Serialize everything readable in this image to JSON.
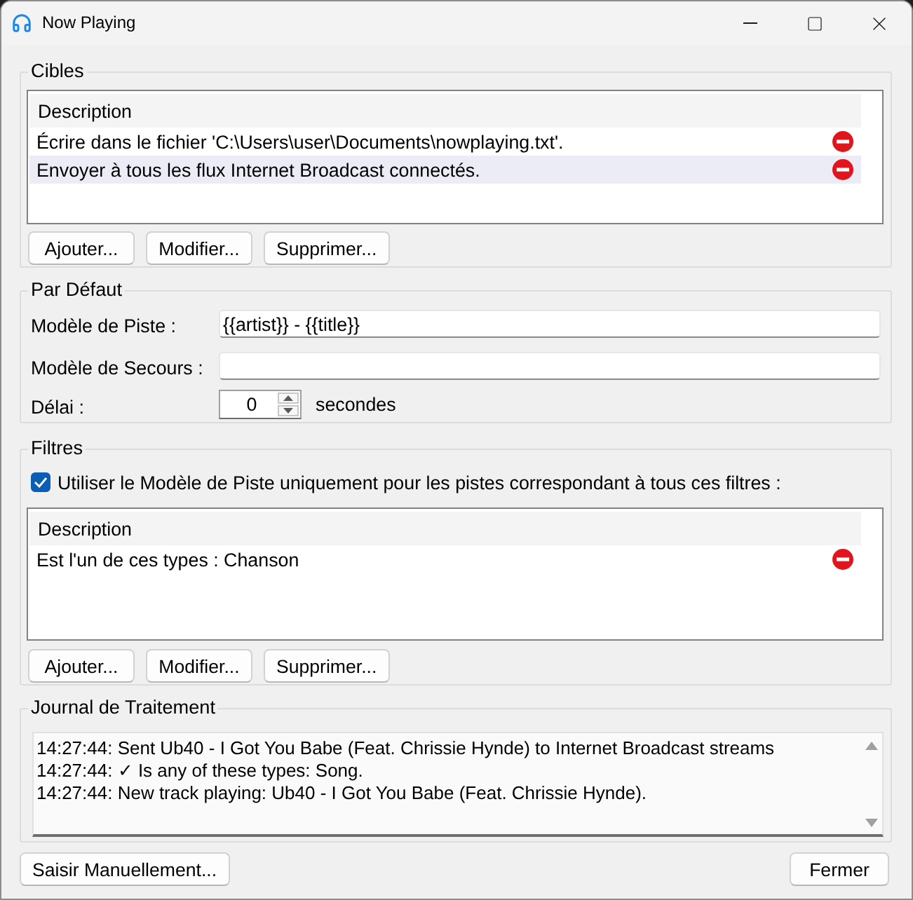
{
  "window": {
    "title": "Now Playing"
  },
  "targets": {
    "title": "Cibles",
    "column": "Description",
    "rows": [
      {
        "text": "Écrire dans le fichier 'C:\\Users\\user\\Documents\\nowplaying.txt'.",
        "selected": false
      },
      {
        "text": "Envoyer à tous les flux Internet Broadcast connectés.",
        "selected": true
      }
    ],
    "buttons": [
      "Ajouter...",
      "Modifier...",
      "Supprimer..."
    ]
  },
  "defaults": {
    "title": "Par Défaut",
    "fields": [
      {
        "label": "Modèle de Piste :",
        "value": "{{artist}} - {{title}}"
      },
      {
        "label": "Modèle de Secours :"
      }
    ],
    "delay": {
      "label": "Délai :",
      "value": "0",
      "unit": "secondes"
    }
  },
  "filters": {
    "title": "Filtres",
    "checkbox": {
      "label": "Utiliser le Modèle de Piste uniquement pour les pistes correspondant à tous ces filtres :",
      "checked": true
    },
    "column": "Description",
    "rows": [
      {
        "text": "Est l'un de ces types : Chanson",
        "selected": false
      }
    ],
    "buttons": [
      "Ajouter...",
      "Modifier...",
      "Supprimer..."
    ]
  },
  "log": {
    "title": "Journal de Traitement",
    "lines": [
      "14:27:44: Sent Ub40 - I Got You Babe (Feat. Chrissie Hynde) to Internet Broadcast streams",
      "14:27:44: ✓ Is any of these types: Song.",
      "14:27:44: New track playing: Ub40 - I Got You Babe (Feat. Chrissie Hynde)."
    ]
  },
  "footer": {
    "buttons": [
      "Saisir Manuellement...",
      "Fermer"
    ]
  }
}
